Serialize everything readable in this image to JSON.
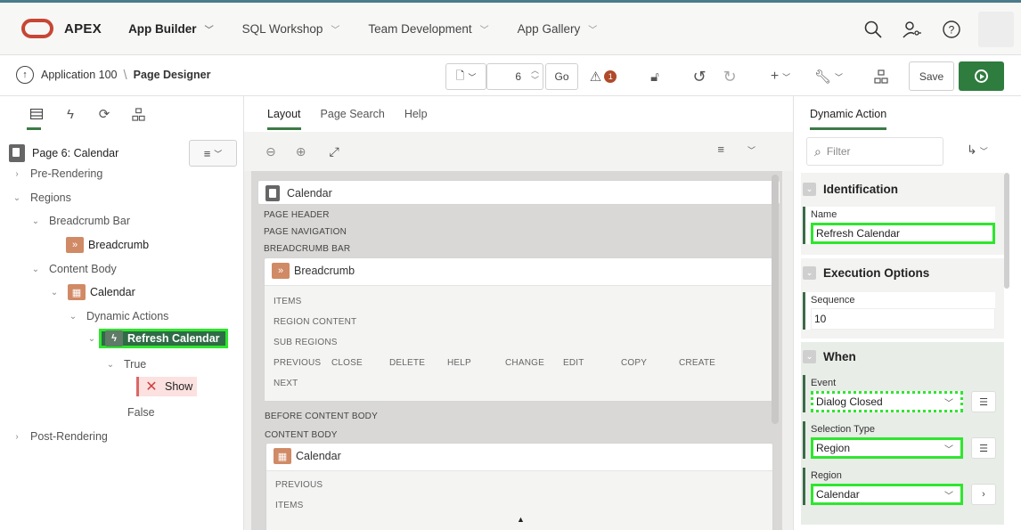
{
  "app": {
    "brand": "APEX",
    "nav": [
      {
        "label": "App Builder",
        "active": true
      },
      {
        "label": "SQL Workshop"
      },
      {
        "label": "Team Development"
      },
      {
        "label": "App Gallery"
      }
    ],
    "icons": [
      "search-icon",
      "user-key-icon",
      "help-icon"
    ]
  },
  "toolbar": {
    "breadcrumb_app": "Application 100",
    "breadcrumb_page": "Page Designer",
    "page_number": "6",
    "go_label": "Go",
    "issues_count": "1",
    "save_label": "Save"
  },
  "left": {
    "page_title": "Page 6: Calendar",
    "tree": {
      "pre_rendering": "Pre-Rendering",
      "regions": "Regions",
      "breadcrumb_bar": "Breadcrumb Bar",
      "breadcrumb": "Breadcrumb",
      "content_body": "Content Body",
      "calendar": "Calendar",
      "dynamic_actions": "Dynamic Actions",
      "refresh_calendar": "Refresh Calendar",
      "true": "True",
      "show": "Show",
      "false": "False",
      "post_rendering": "Post-Rendering"
    }
  },
  "center": {
    "tabs": [
      "Layout",
      "Page Search",
      "Help"
    ],
    "layout": {
      "page_box": "Calendar",
      "page_header": "PAGE HEADER",
      "page_navigation": "PAGE NAVIGATION",
      "breadcrumb_bar": "BREADCRUMB BAR",
      "breadcrumb_region": "Breadcrumb",
      "items": "ITEMS",
      "region_content": "REGION CONTENT",
      "sub_regions": "SUB REGIONS",
      "buttons": [
        "PREVIOUS",
        "CLOSE",
        "DELETE",
        "HELP",
        "CHANGE",
        "EDIT",
        "COPY",
        "CREATE"
      ],
      "next": "NEXT",
      "before_content_body": "BEFORE CONTENT BODY",
      "content_body": "CONTENT BODY",
      "calendar_region": "Calendar",
      "cal_previous": "PREVIOUS",
      "cal_items": "ITEMS"
    }
  },
  "right": {
    "tab": "Dynamic Action",
    "filter_placeholder": "Filter",
    "groups": {
      "identification": "Identification",
      "execution_options": "Execution Options",
      "when": "When"
    },
    "props": {
      "name_label": "Name",
      "name_value": "Refresh Calendar",
      "sequence_label": "Sequence",
      "sequence_value": "10",
      "event_label": "Event",
      "event_value": "Dialog Closed",
      "selection_type_label": "Selection Type",
      "selection_type_value": "Region",
      "region_label": "Region",
      "region_value": "Calendar"
    }
  }
}
